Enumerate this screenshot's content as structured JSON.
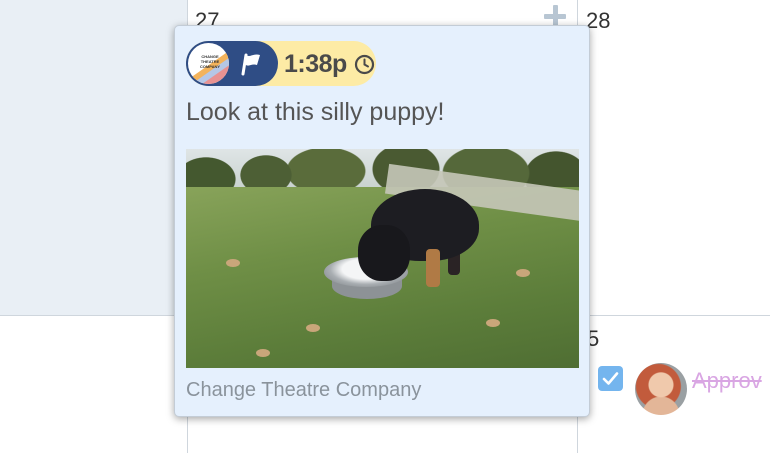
{
  "calendar": {
    "days": [
      {
        "number": "27"
      },
      {
        "number": "28"
      },
      {
        "number": "5"
      }
    ]
  },
  "popup": {
    "time": "1:38p",
    "title": "Look at this silly puppy!",
    "organization": "Change Theatre Company",
    "logo_text": "CHANGE THEATRE COMPANY",
    "icons": [
      "logo",
      "flag-icon",
      "clock-icon"
    ],
    "colors": {
      "pill_dark": "#2f4d85",
      "pill_light": "#fdeba5",
      "popup_bg": "#e5f0fd"
    }
  },
  "other_event": {
    "label": "Approv",
    "checked": true
  }
}
